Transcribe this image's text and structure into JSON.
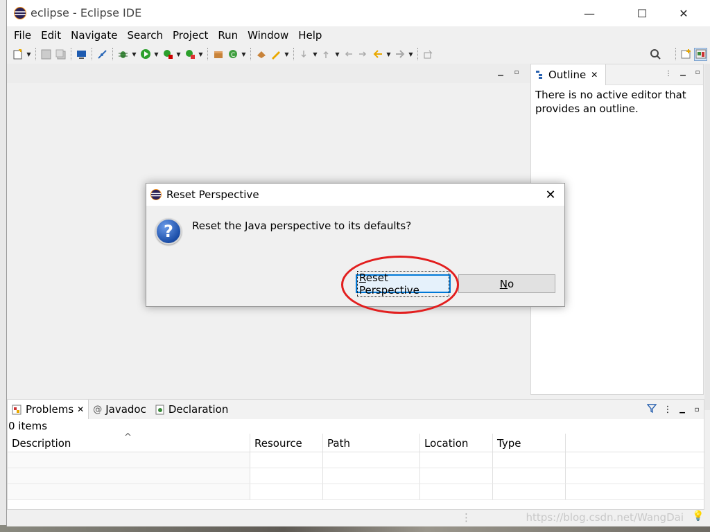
{
  "window": {
    "title": "eclipse - Eclipse IDE",
    "controls": {
      "minimize": "—",
      "maximize": "☐",
      "close": "✕"
    }
  },
  "menu": [
    "File",
    "Edit",
    "Navigate",
    "Search",
    "Project",
    "Run",
    "Window",
    "Help"
  ],
  "outline": {
    "tab_label": "Outline",
    "message": "There is no active editor that provides an outline."
  },
  "problems_panel": {
    "tabs": [
      {
        "label": "Problems",
        "icon": "problems-icon",
        "active": true
      },
      {
        "label": "Javadoc",
        "icon": "javadoc-icon",
        "active": false
      },
      {
        "label": "Declaration",
        "icon": "declaration-icon",
        "active": false
      }
    ],
    "items_count": "0 items",
    "columns": [
      "Description",
      "Resource",
      "Path",
      "Location",
      "Type"
    ],
    "sort_indicator": "^"
  },
  "status": {
    "watermark": "https://blog.csdn.net/WangDai"
  },
  "dialog": {
    "title": "Reset Perspective",
    "message": "Reset the Java perspective to its defaults?",
    "icon": "question-icon",
    "primary_button": {
      "mnemonic": "R",
      "rest": "eset Perspective"
    },
    "secondary_button": {
      "mnemonic": "N",
      "rest": "o"
    }
  },
  "colors": {
    "accent": "#0078d7",
    "annotation_ring": "#e21e1e"
  }
}
